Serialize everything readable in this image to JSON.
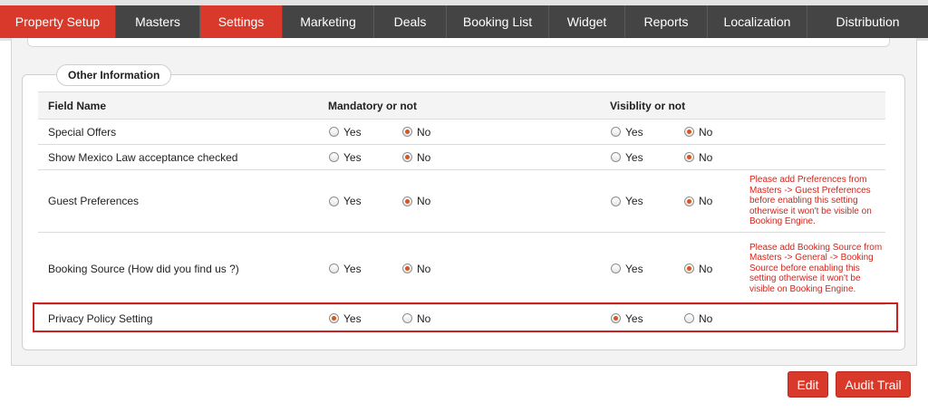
{
  "nav": {
    "tabs": [
      {
        "label": "Property Setup",
        "active": true
      },
      {
        "label": "Masters",
        "active": false
      },
      {
        "label": "Settings",
        "active": true
      },
      {
        "label": "Marketing",
        "active": false
      },
      {
        "label": "Deals",
        "active": false
      },
      {
        "label": "Booking List",
        "active": false
      },
      {
        "label": "Widget",
        "active": false
      },
      {
        "label": "Reports",
        "active": false
      },
      {
        "label": "Localization",
        "active": false
      },
      {
        "label": "Distribution",
        "active": false
      }
    ]
  },
  "section": {
    "title": "Other Information",
    "headers": {
      "field": "Field Name",
      "mandatory": "Mandatory or not",
      "visibility": "Visiblity or not"
    },
    "option_yes": "Yes",
    "option_no": "No",
    "rows": [
      {
        "field": "Special Offers",
        "mandatory": "No",
        "visibility": "No",
        "note": ""
      },
      {
        "field": "Show Mexico Law acceptance checked",
        "mandatory": "No",
        "visibility": "No",
        "note": ""
      },
      {
        "field": "Guest Preferences",
        "mandatory": "No",
        "visibility": "No",
        "note": "Please add Preferences from Masters -> Guest Preferences before enabling this setting otherwise it won't be visible on Booking Engine."
      },
      {
        "field": "Booking Source (How did you find us ?)",
        "mandatory": "No",
        "visibility": "No",
        "note": "Please add Booking Source from Masters -> General -> Booking Source before enabling this setting otherwise it won't be visible on Booking Engine."
      },
      {
        "field": "Privacy Policy Setting",
        "mandatory": "Yes",
        "visibility": "Yes",
        "note": ""
      }
    ]
  },
  "actions": {
    "edit_label": "Edit",
    "audit_label": "Audit Trail"
  },
  "colors": {
    "accent": "#d9392b",
    "nav_bg": "#444444",
    "note_text": "#d0251b",
    "highlight_border": "#cc1f1f"
  }
}
